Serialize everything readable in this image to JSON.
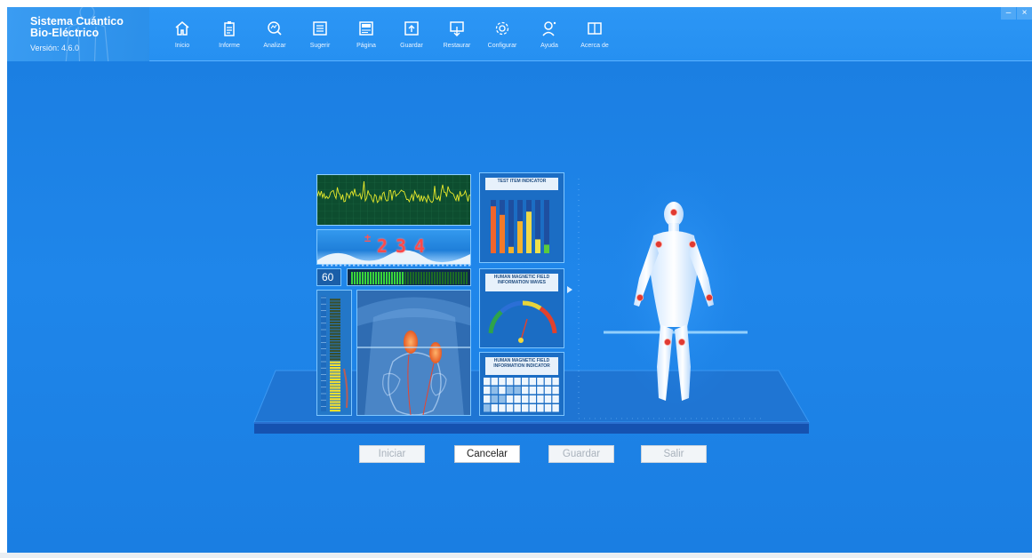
{
  "app": {
    "title_line1": "Sistema Cuántico",
    "title_line2": "Bio-Eléctrico",
    "version": "Versión: 4.6.0"
  },
  "toolbar": {
    "items": [
      {
        "label": "Inicio",
        "icon": "home-icon"
      },
      {
        "label": "Informe",
        "icon": "clipboard-icon"
      },
      {
        "label": "Analizar",
        "icon": "magnify-analyze-icon"
      },
      {
        "label": "Sugerir",
        "icon": "list-icon"
      },
      {
        "label": "Página",
        "icon": "page-icon"
      },
      {
        "label": "Guardar",
        "icon": "save-upload-icon"
      },
      {
        "label": "Restaurar",
        "icon": "restore-download-icon"
      },
      {
        "label": "Configurar",
        "icon": "gear-icon"
      },
      {
        "label": "Ayuda",
        "icon": "user-help-icon"
      },
      {
        "label": "Acerca de",
        "icon": "book-icon"
      }
    ]
  },
  "window_controls": {
    "minimize": "–",
    "close": "×"
  },
  "device": {
    "counter_sign": "±",
    "counter_digits": [
      "2",
      "3",
      "4"
    ],
    "speed_value": "60",
    "meter_fill_fraction": 0.45,
    "vertical_meter_fill_fraction": 0.45,
    "test_item_indicator_title": "TEST ITEM INDICATOR",
    "test_item_bars": [
      {
        "color": "#f0652b",
        "level": 0.88
      },
      {
        "color": "#f37a2a",
        "level": 0.72
      },
      {
        "color": "#f3b22c",
        "level": 0.12
      },
      {
        "color": "#f3b22c",
        "level": 0.6
      },
      {
        "color": "#f0d948",
        "level": 0.78
      },
      {
        "color": "#f0e24a",
        "level": 0.26
      },
      {
        "color": "#5bcb3b",
        "level": 0.16
      }
    ],
    "magnetic_waves_title": "HUMAN MAGNETIC FIELD INFORMATION WAVES",
    "magnetic_indicator_title": "HUMAN MAGNETIC FIELD INFORMATION INDICATOR"
  },
  "buttons": {
    "start": "Iniciar",
    "cancel": "Cancelar",
    "save": "Guardar",
    "exit": "Salir"
  },
  "colors": {
    "background": "#1f86ea",
    "topbar": "#2c96f5",
    "accent_red": "#e03a32"
  }
}
